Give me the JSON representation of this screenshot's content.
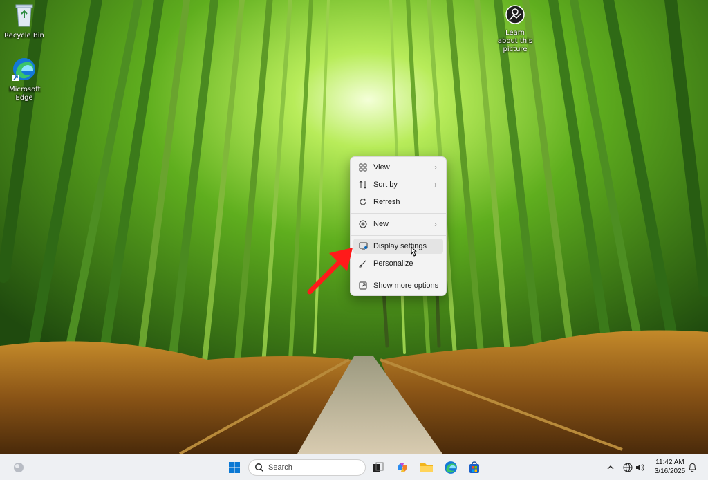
{
  "desktop": {
    "icons": [
      {
        "label": "Recycle Bin"
      },
      {
        "label": "Microsoft Edge"
      },
      {
        "label": "Learn about this picture"
      }
    ]
  },
  "context_menu": {
    "items": [
      {
        "label": "View",
        "icon": "grid-view-icon",
        "submenu": true
      },
      {
        "label": "Sort by",
        "icon": "sort-icon",
        "submenu": true
      },
      {
        "label": "Refresh",
        "icon": "refresh-icon",
        "submenu": false
      },
      {
        "label": "New",
        "icon": "plus-circle-icon",
        "submenu": true
      },
      {
        "label": "Display settings",
        "icon": "display-icon",
        "submenu": false,
        "hovered": true
      },
      {
        "label": "Personalize",
        "icon": "brush-icon",
        "submenu": false
      },
      {
        "label": "Show more options",
        "icon": "more-options-icon",
        "submenu": false
      }
    ]
  },
  "taskbar": {
    "search_placeholder": "Search",
    "apps": [
      "start-icon",
      "task-view-icon",
      "copilot-icon",
      "file-explorer-icon",
      "edge-icon",
      "store-icon"
    ],
    "clock": {
      "time": "11:42 AM",
      "date": "3/16/2025"
    }
  },
  "colors": {
    "menu_bg": "#f3f3f3",
    "accent": "#0067c0",
    "arrow": "#ff1a1a",
    "taskbar_bg": "#eef0f3"
  }
}
